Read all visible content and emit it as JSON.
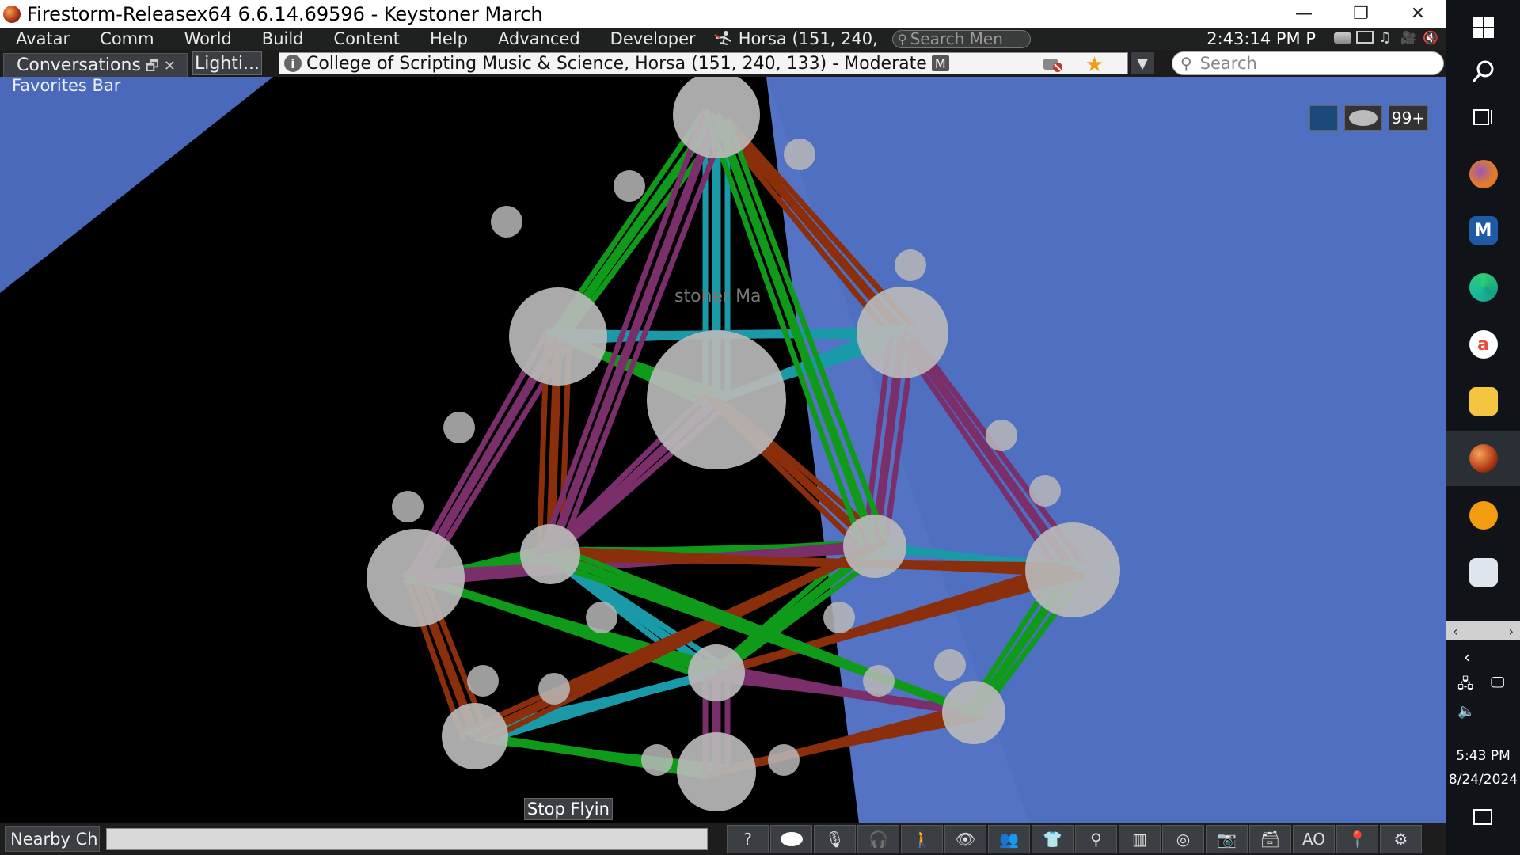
{
  "window": {
    "title": "Firestorm-Releasex64 6.6.14.69596 - Keystoner March",
    "minimize": "—",
    "restore": "❐",
    "close": "✕"
  },
  "menubar": {
    "items": [
      "Avatar",
      "Comm",
      "World",
      "Build",
      "Content",
      "Help",
      "Advanced",
      "Developer"
    ],
    "location": "Horsa (151, 240,",
    "search_placeholder": "Search Men",
    "clock": "2:43:14 PM P"
  },
  "navrow": {
    "conversations_tab": "Conversations",
    "tab_controls": "🗗✕",
    "lighting_tab": "Lighti...",
    "location_text": "College of Scripting Music & Science, Horsa (151, 240, 133) - Moderate",
    "maturity_badge": "M",
    "search_placeholder": "Search"
  },
  "favorites_bar": "Favorites Bar",
  "scene": {
    "avatar_tag": "stoner Ma",
    "top_right_badge": "99+",
    "stop_flying": "Stop Flyin",
    "colors": {
      "sky": "#4f6fc0",
      "rod_green": "#109a1a",
      "rod_purple": "#7a2f6b",
      "rod_brown": "#8a2e0c",
      "rod_teal": "#1a9aa8",
      "sphere": "#b8b8b8"
    }
  },
  "bottombar": {
    "nearby_chat": "Nearby Ch",
    "toolbar_icons": [
      "help-icon",
      "chat-icon",
      "voice-icon",
      "headphones-icon",
      "walk-icon",
      "camera-view-icon",
      "people-icon",
      "appearance-icon",
      "search-icon",
      "map-icon",
      "radar-icon",
      "snapshot-icon",
      "inventory-icon",
      "ao-icon",
      "place-icon",
      "preferences-icon"
    ],
    "ao_label": "AO"
  },
  "taskbar": {
    "time": "5:43 PM",
    "date": "8/24/2024",
    "apps": [
      "windows-start-icon",
      "search-icon",
      "task-view-icon",
      "firefox-icon",
      "m-app-icon",
      "edge-icon",
      "acrobat-icon",
      "sticky-notes-icon",
      "firestorm-icon",
      "audacity-icon",
      "network-app-icon"
    ]
  }
}
